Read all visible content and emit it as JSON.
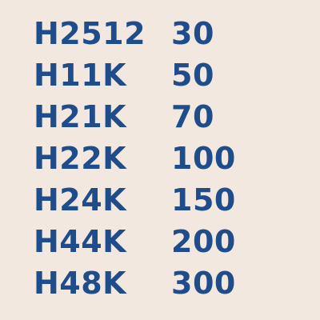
{
  "colors": {
    "background": "#f2e8e0",
    "text": "#1f4c8a"
  },
  "rows": [
    {
      "code": "H2512",
      "value": "30"
    },
    {
      "code": "H11K",
      "value": "50"
    },
    {
      "code": "H21K",
      "value": "70"
    },
    {
      "code": "H22K",
      "value": "100"
    },
    {
      "code": "H24K",
      "value": "150"
    },
    {
      "code": "H44K",
      "value": "200"
    },
    {
      "code": "H48K",
      "value": "300"
    }
  ]
}
